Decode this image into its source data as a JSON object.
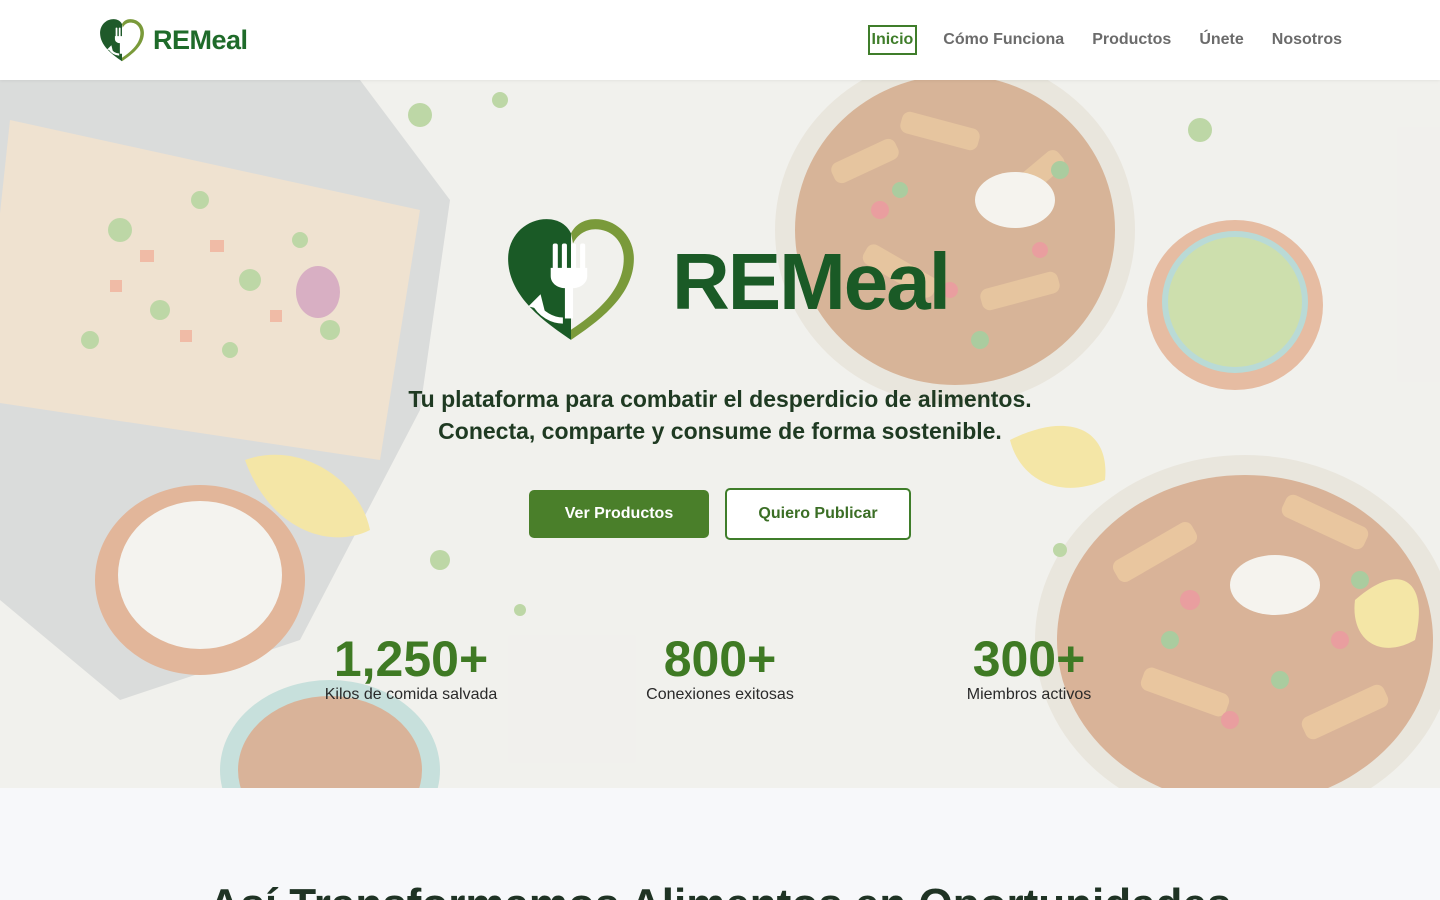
{
  "header": {
    "brand_name": "REMeal",
    "nav": [
      {
        "label": "Inicio",
        "active": true
      },
      {
        "label": "Cómo Funciona",
        "active": false
      },
      {
        "label": "Productos",
        "active": false
      },
      {
        "label": "Únete",
        "active": false
      },
      {
        "label": "Nosotros",
        "active": false
      }
    ]
  },
  "hero": {
    "logo_name": "REMeal",
    "tagline_line1": "Tu plataforma para combatir el desperdicio de alimentos.",
    "tagline_line2": "Conecta, comparte y consume de forma sostenible.",
    "primary_button": "Ver Productos",
    "secondary_button": "Quiero Publicar",
    "stats": [
      {
        "value": "1,250+",
        "label": "Kilos de comida salvada"
      },
      {
        "value": "800+",
        "label": "Conexiones exitosas"
      },
      {
        "value": "300+",
        "label": "Miembros activos"
      }
    ]
  },
  "section2": {
    "title": "Así Transformamos Alimentos en Oportunidades"
  },
  "colors": {
    "brand_green": "#1f6b2a",
    "accent_green": "#4a7f2a",
    "logo_light_green": "#7a9a3a"
  },
  "icons": {
    "logo": "heart-fork-recycle-icon"
  }
}
